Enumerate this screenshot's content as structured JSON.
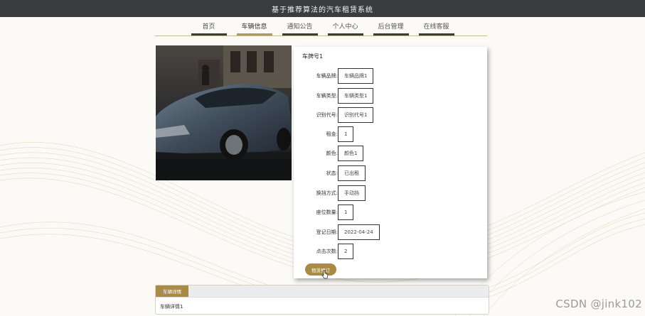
{
  "header": {
    "title": "基于推荐算法的汽车租赁系统"
  },
  "nav": {
    "items": [
      {
        "label": "首页",
        "active": false
      },
      {
        "label": "车辆信息",
        "active": true
      },
      {
        "label": "通知公告",
        "active": false
      },
      {
        "label": "个人中心",
        "active": false
      },
      {
        "label": "后台管理",
        "active": false
      },
      {
        "label": "在线客服",
        "active": false
      }
    ]
  },
  "car": {
    "plate": "车牌号1",
    "fields": [
      {
        "label": "车辆品牌:",
        "value": "车辆品牌1"
      },
      {
        "label": "车辆类型:",
        "value": "车辆类型1"
      },
      {
        "label": "识别代号:",
        "value": "识别代号1"
      },
      {
        "label": "租金:",
        "value": "1"
      },
      {
        "label": "颜色:",
        "value": "颜色1"
      },
      {
        "label": "状态:",
        "value": "已出租"
      },
      {
        "label": "换挡方式:",
        "value": "手动挡"
      },
      {
        "label": "座位数量:",
        "value": "1"
      },
      {
        "label": "登记日期:",
        "value": "2022-04-24"
      },
      {
        "label": "点击次数:",
        "value": "2"
      }
    ],
    "rent_button": "租赁预订"
  },
  "detail": {
    "tab_label": "车辆详情",
    "content": "车辆详情1"
  },
  "watermark": "CSDN @jink102",
  "colors": {
    "accent": "#a98b45",
    "topbar": "#3a3d40"
  }
}
